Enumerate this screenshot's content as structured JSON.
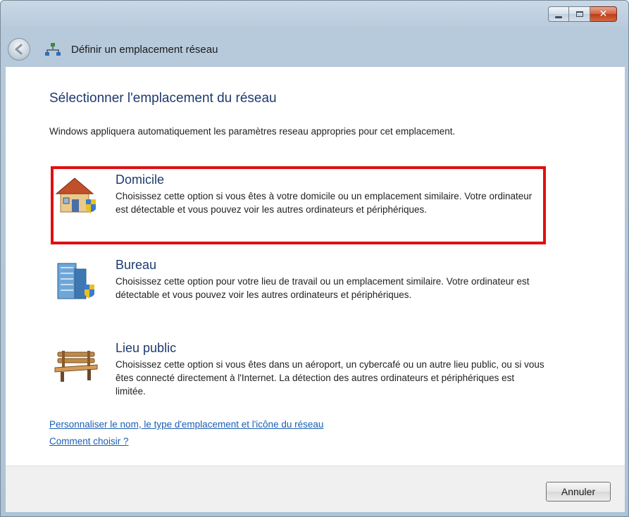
{
  "window": {
    "title": "Définir un emplacement réseau",
    "controls": [
      "minimize-icon",
      "maximize-icon",
      "close-icon"
    ]
  },
  "main": {
    "heading": "Sélectionner l'emplacement du réseau",
    "intro": "Windows appliquera automatiquement les paramètres reseau appropries pour cet emplacement.",
    "options": [
      {
        "title": "Domicile",
        "description": "Choisissez cette option si vous êtes à votre domicile ou un emplacement similaire. Votre ordinateur est détectable et vous pouvez voir les autres ordinateurs et périphériques.",
        "icon": "house-icon",
        "highlighted": true
      },
      {
        "title": "Bureau",
        "description": "Choisissez cette option pour votre lieu de travail ou un emplacement similaire. Votre ordinateur est détectable et vous pouvez voir les autres ordinateurs et périphériques.",
        "icon": "office-building-icon",
        "highlighted": false
      },
      {
        "title": "Lieu public",
        "description": "Choisissez cette option si vous êtes dans un aéroport, un cybercafé ou un autre lieu public, ou si vous êtes connecté directement à l'Internet. La détection des autres ordinateurs et périphériques est limitée.",
        "icon": "park-bench-icon",
        "highlighted": false
      }
    ],
    "links": {
      "customize": "Personnaliser le nom, le type d'emplacement et l'icône du réseau",
      "help": "Comment choisir ?"
    }
  },
  "footer": {
    "cancel_label": "Annuler"
  },
  "colors": {
    "highlight_border": "#e01010",
    "heading": "#1e3a6e",
    "link": "#1a5fb4"
  }
}
